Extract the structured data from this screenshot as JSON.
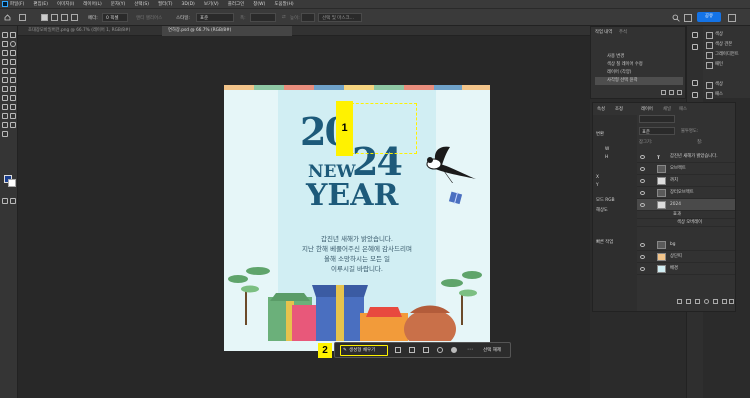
{
  "menu": {
    "items": [
      "파일(F)",
      "편집(E)",
      "이미지(I)",
      "레이어(L)",
      "문자(Y)",
      "선택(S)",
      "필터(T)",
      "3D(D)",
      "보기(V)",
      "플러그인",
      "창(W)",
      "도움말(H)"
    ]
  },
  "options_bar": {
    "feather_label": "페더:",
    "feather_value": "0 픽셀",
    "antialias": "앤티 앨리어스",
    "style_label": "스타일:",
    "style_value": "표준",
    "width_label": "폭:",
    "height_label": "높이:",
    "select_mask_button": "선택 및 마스크...",
    "share_button": "공유"
  },
  "tabs": [
    {
      "label": "초대장모바일버전.png @ 66.7% (레이어 1, RGB/8#)"
    },
    {
      "label": "연하장.psd @ 66.7% (RGB/8#)"
    }
  ],
  "canvas": {
    "year_top": "20",
    "year_bottom": "24",
    "new_text": "NEW",
    "year_word": "YEAR",
    "message_lines": [
      "갑진년 새해가 밝았습니다.",
      "지난 한해 베풀어주신 은혜에 감사드리며",
      "올해 소망하시는 모든 일",
      "이루시길 바랍니다."
    ],
    "marker_1": "1",
    "marker_2": "2"
  },
  "taskbar": {
    "generative_fill": "생성형 채우기",
    "deselect": "선택 해제"
  },
  "history_panel": {
    "tab_history": "작업 내역",
    "tab_notes": "주석",
    "rows": [
      "사용 변경",
      "색상 칠 레이어 수정",
      "레이어 (각양)",
      "사각형 선택 윤곽"
    ]
  },
  "right_panel": {
    "items": [
      "색상",
      "색상 견본",
      "그레이디언트",
      "패턴",
      "색상",
      "패스"
    ]
  },
  "layers_panel": {
    "tabs": [
      "레이어",
      "채널",
      "패스"
    ],
    "side_tabs": [
      "속성",
      "조정"
    ],
    "blend_mode": "표준",
    "opacity_label": "불투명도:",
    "fill_label": "칠:",
    "lock_label": "잠그기:",
    "rows": [
      {
        "name": "갑진년 새해가 밝았습니다."
      },
      {
        "name": "오브젝트"
      },
      {
        "name": "까치"
      },
      {
        "name": "장터오브젝트"
      },
      {
        "name": "2024"
      },
      {
        "name": "효과"
      },
      {
        "name": "색상 오버레이"
      },
      {
        "name": "bg"
      },
      {
        "name": "상단띠"
      },
      {
        "name": "배경"
      }
    ]
  },
  "properties_mini": {
    "rows": [
      "변환",
      "W",
      "H",
      "X",
      "Y",
      "모드 RGB",
      "해상도"
    ],
    "adjust_label": "빠른 작업"
  },
  "colors": {
    "accent": "#1473e6",
    "marker_yellow": "#fff200",
    "title_navy": "#1d5a7a",
    "foreground": "#1b3f8f"
  }
}
